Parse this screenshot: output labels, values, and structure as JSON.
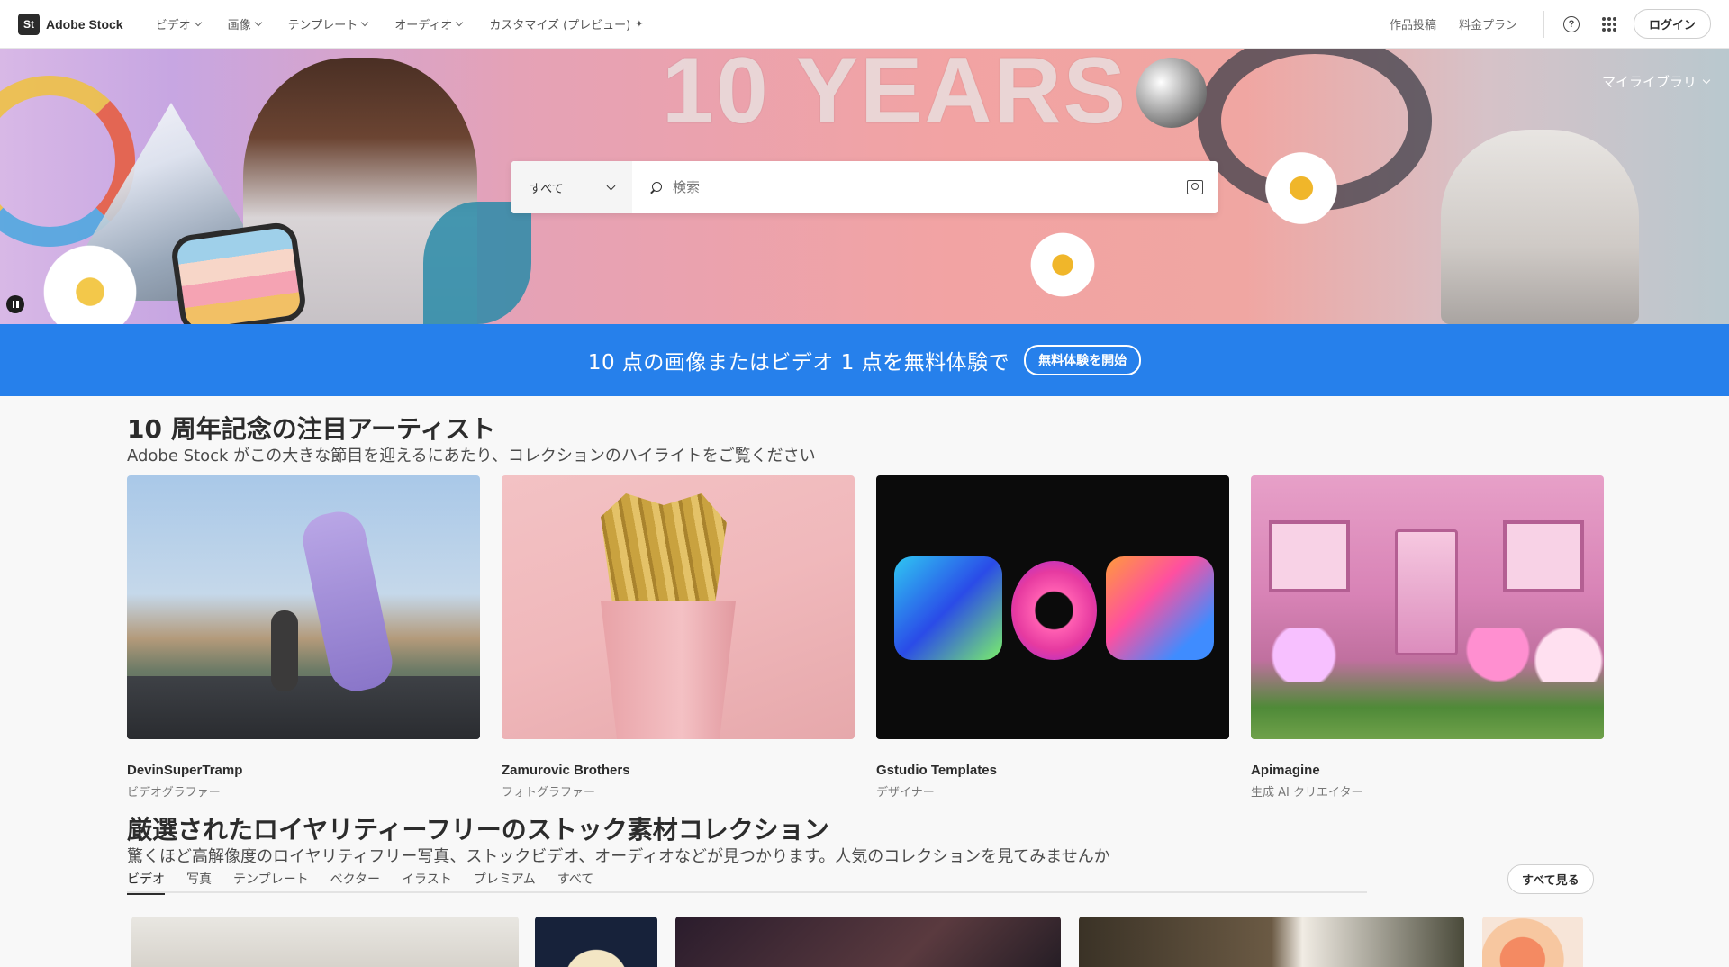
{
  "header": {
    "logo_badge": "St",
    "logo_text": "Adobe Stock",
    "nav": [
      {
        "label": "ビデオ"
      },
      {
        "label": "画像"
      },
      {
        "label": "テンプレート"
      },
      {
        "label": "オーディオ"
      },
      {
        "label": "カスタマイズ (プレビュー)"
      }
    ],
    "contributor_link": "作品投稿",
    "pricing_link": "料金プラン",
    "login_label": "ログイン"
  },
  "hero": {
    "background_text": "10 YEARS",
    "library_label": "マイライブラリ",
    "search": {
      "category": "すべて",
      "placeholder": "検索"
    }
  },
  "promo": {
    "text": "10 点の画像またはビデオ 1 点を無料体験で",
    "button_label": "無料体験を開始"
  },
  "artists": {
    "title": "10 周年記念の注目アーティスト",
    "subtitle": "Adobe Stock がこの大きな節目を迎えるにあたり、コレクションのハイライトをご覧ください",
    "cards": [
      {
        "name": "DevinSuperTramp",
        "role": "ビデオグラファー"
      },
      {
        "name": "Zamurovic Brothers",
        "role": "フォトグラファー"
      },
      {
        "name": "Gstudio Templates",
        "role": "デザイナー"
      },
      {
        "name": "Apimagine",
        "role": "生成 AI クリエイター"
      }
    ]
  },
  "collection": {
    "title": "厳選されたロイヤリティーフリーのストック素材コレクション",
    "subtitle": "驚くほど高解像度のロイヤリティフリー写真、ストックビデオ、オーディオなどが見つかります。人気のコレクションを見てみませんか",
    "tabs": [
      {
        "label": "ビデオ"
      },
      {
        "label": "写真"
      },
      {
        "label": "テンプレート"
      },
      {
        "label": "ベクター"
      },
      {
        "label": "イラスト"
      },
      {
        "label": "プレミアム"
      },
      {
        "label": "すべて"
      }
    ],
    "see_all_label": "すべて見る"
  },
  "colors": {
    "promo_blue": "#2680eb",
    "text_dark": "#2c2c2c"
  }
}
